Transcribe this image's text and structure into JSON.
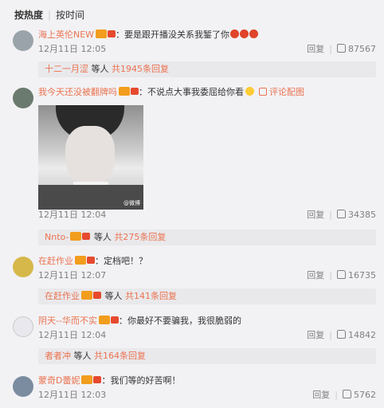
{
  "tabs": {
    "hot": "按热度",
    "time": "按时间"
  },
  "comments": [
    {
      "user": "海上英伦NEW",
      "text": "：要是跟开播没关系我錾了你",
      "time": "12月11日 12:05",
      "reply": "回复",
      "likes": "87567",
      "sub": {
        "who": "十二一月涩",
        "mid": " 等人 ",
        "more": "共1945条回复"
      }
    },
    {
      "user": "我今天还没被翻牌吗",
      "text": "：不说点大事我委屈给你看",
      "pic": "评论配图",
      "photo_mark": "@微博",
      "time": "12月11日 12:04",
      "reply": "回复",
      "likes": "34385",
      "sub": {
        "who": "Nnto-",
        "mid": " 等人 ",
        "more": "共275条回复"
      }
    },
    {
      "user": "在赶作业",
      "text": "：定档吧！？",
      "time": "12月11日 12:07",
      "reply": "回复",
      "likes": "16735",
      "sub": {
        "who": "在赶作业",
        "mid": " 等人 ",
        "more": "共141条回复"
      }
    },
    {
      "user": "阴天--华而不实",
      "text": "：你最好不要骗我，我很脆弱的",
      "time": "12月11日 12:04",
      "reply": "回复",
      "likes": "14842",
      "sub": {
        "who": "者者冲",
        "mid": " 等人 ",
        "more": "共164条回复"
      }
    },
    {
      "user": "蒙奇D蕾妮",
      "text": "：我们等的好苦啊！",
      "time": "12月11日 12:03",
      "reply": "回复",
      "likes": "5762"
    }
  ]
}
